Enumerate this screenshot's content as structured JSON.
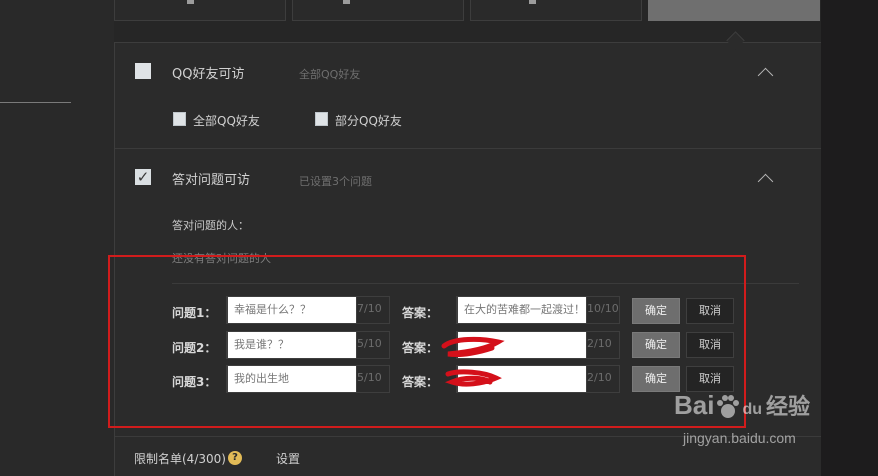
{
  "section_qq": {
    "title": "QQ好友可访",
    "subtitle": "全部QQ好友",
    "options": [
      "全部QQ好友",
      "部分QQ好友"
    ]
  },
  "section_question": {
    "title": "答对问题可访",
    "subtitle": "已设置3个问题",
    "answered_label": "答对问题的人：",
    "answered_empty": "还没有答对问题的人"
  },
  "questions": [
    {
      "label": "问题1：",
      "question": "幸福是什么？？",
      "q_count": "7/10",
      "answer_label": "答案：",
      "answer": "在大的苦难都一起渡过！",
      "a_count": "10/10",
      "confirm": "确定",
      "cancel": "取消"
    },
    {
      "label": "问题2：",
      "question": "我是谁？？",
      "q_count": "5/10",
      "answer_label": "答案：",
      "answer": "",
      "a_count": "2/10",
      "confirm": "确定",
      "cancel": "取消"
    },
    {
      "label": "问题3：",
      "question": "我的出生地",
      "q_count": "5/10",
      "answer_label": "答案：",
      "answer": "",
      "a_count": "2/10",
      "confirm": "确定",
      "cancel": "取消"
    }
  ],
  "footer": {
    "limit_label": "限制名单(4/300)",
    "help_icon_glyph": "?",
    "settings_link": "设置"
  },
  "watermark": {
    "brand_left": "Bai",
    "brand_right": "百",
    "brand_du": "du",
    "brand_cn": "经验",
    "url": "jingyan.baidu.com"
  },
  "colors": {
    "accent_red": "#d11c1c",
    "background": "#262626",
    "panel": "#2b2b2b"
  }
}
